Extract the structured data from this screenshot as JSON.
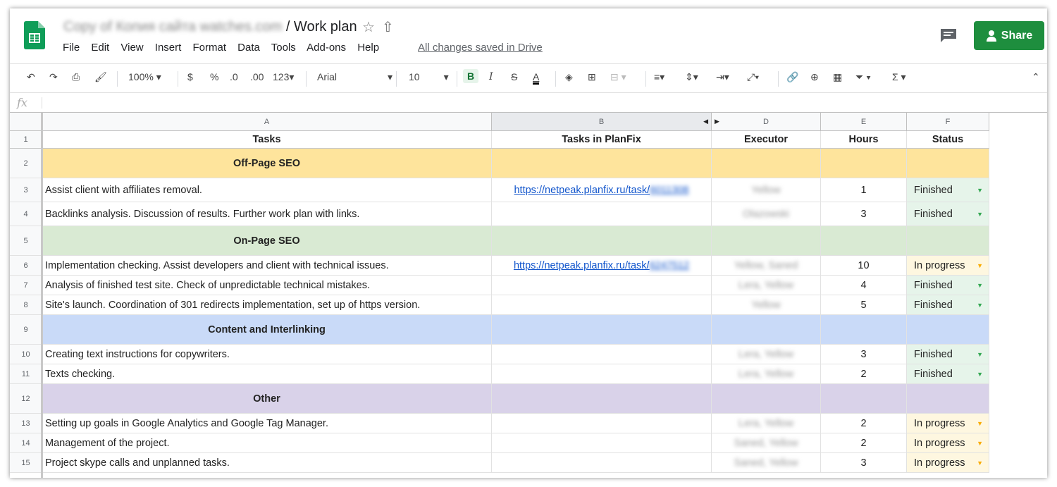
{
  "header": {
    "doc_title_blurred": "Copy of Копия сайта watches.com",
    "doc_title": " / Work plan",
    "star_icon": "star-icon",
    "drive_icon": "move-to-drive-icon",
    "menu": [
      "File",
      "Edit",
      "View",
      "Insert",
      "Format",
      "Data",
      "Tools",
      "Add-ons",
      "Help"
    ],
    "saved_status": "All changes saved in Drive",
    "share_label": "Share",
    "accent": "#1e8e3e"
  },
  "toolbar": {
    "zoom": "100%",
    "currency": "$",
    "percent": "%",
    "dec_less": ".0",
    "dec_more": ".00",
    "more_formats": "123",
    "font": "Arial",
    "font_size": "10",
    "bold": "B",
    "italic": "I",
    "strike": "S",
    "text_color": "A"
  },
  "formula_bar": {
    "fx": "fx"
  },
  "columns": [
    "A",
    "B",
    "D",
    "E",
    "F"
  ],
  "rows": [
    {
      "num": "1",
      "type": "header",
      "a": "Tasks",
      "b": "Tasks in PlanFix",
      "d": "Executor",
      "e": "Hours",
      "f": "Status"
    },
    {
      "num": "2",
      "type": "section",
      "color": "#fee49c",
      "a": "Off-Page SEO"
    },
    {
      "num": "3",
      "type": "task",
      "a": "Assist client with affiliates removal.",
      "b": "https://netpeak.planfix.ru/task/",
      "b_blur": "6011308",
      "d": "Yellow",
      "e": "1",
      "f": "Finished"
    },
    {
      "num": "4",
      "type": "task",
      "a": "Backlinks analysis. Discussion of results. Further work plan with links.",
      "b": "",
      "d": "Olazowski",
      "e": "3",
      "f": "Finished"
    },
    {
      "num": "5",
      "type": "section",
      "color": "#d9ead3",
      "a": "On-Page SEO"
    },
    {
      "num": "6",
      "type": "task",
      "a": "Implementation checking. Assist developers and client with technical issues.",
      "b": "https://netpeak.planfix.ru/task/",
      "b_blur": "6247512",
      "d": "Yellow, Saned",
      "e": "10",
      "f": "In progress"
    },
    {
      "num": "7",
      "type": "task",
      "a": "Analysis of finished test site. Check of unpredictable technical mistakes.",
      "b": "",
      "d": "Lera, Yellow",
      "e": "4",
      "f": "Finished"
    },
    {
      "num": "8",
      "type": "task",
      "a": "Site's launch. Coordination of 301 redirects implementation, set up of https version.",
      "b": "",
      "d": "Yellow",
      "e": "5",
      "f": "Finished"
    },
    {
      "num": "9",
      "type": "section",
      "color": "#c9daf8",
      "a": "Content and Interlinking"
    },
    {
      "num": "10",
      "type": "task",
      "a": "Creating text instructions for copywriters.",
      "b": "",
      "d": "Lera, Yellow",
      "e": "3",
      "f": "Finished"
    },
    {
      "num": "11",
      "type": "task",
      "a": "Texts checking.",
      "b": "",
      "d": "Lera, Yellow",
      "e": "2",
      "f": "Finished"
    },
    {
      "num": "12",
      "type": "section",
      "color": "#d9d2e9",
      "a": "Other"
    },
    {
      "num": "13",
      "type": "task",
      "a": "Setting up goals in Google Analytics and Google Tag Manager.",
      "b": "",
      "d": "Lera, Yellow",
      "e": "2",
      "f": "In progress"
    },
    {
      "num": "14",
      "type": "task",
      "a": "Management of the project.",
      "b": "",
      "d": "Saned, Yellow",
      "e": "2",
      "f": "In progress"
    },
    {
      "num": "15",
      "type": "task",
      "a": "Project skype calls and unplanned tasks.",
      "b": "",
      "d": "Saned, Yellow",
      "e": "3",
      "f": "In progress"
    }
  ]
}
